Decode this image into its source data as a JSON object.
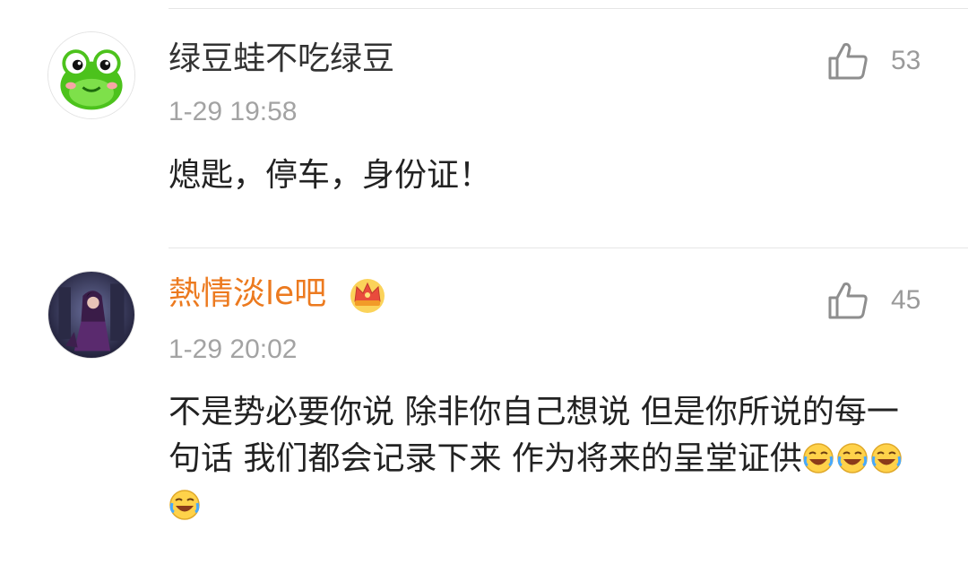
{
  "comments": [
    {
      "username": "绿豆蛙不吃绿豆",
      "is_vip": false,
      "time": "1-29 19:58",
      "likes": "53",
      "avatar": "green-frog-avatar",
      "content": "熄匙，停车，身份证！"
    },
    {
      "username": "熱情淡le吧",
      "is_vip": true,
      "badge": "crown-icon",
      "time": "1-29 20:02",
      "likes": "45",
      "avatar": "dark-fantasy-character-avatar",
      "content": "不是势必要你说 除非你自己想说 但是你所说的每一句话 我们都会记录下来 作为将来的呈堂证供",
      "emojis": [
        "laugh-cry-emoji",
        "laugh-cry-emoji",
        "laugh-cry-emoji",
        "laugh-cry-emoji"
      ]
    }
  ],
  "colors": {
    "vip_name": "#ec7a1f",
    "normal_name": "#333333",
    "meta": "#a3a3a3",
    "divider": "#e6e6e6"
  }
}
